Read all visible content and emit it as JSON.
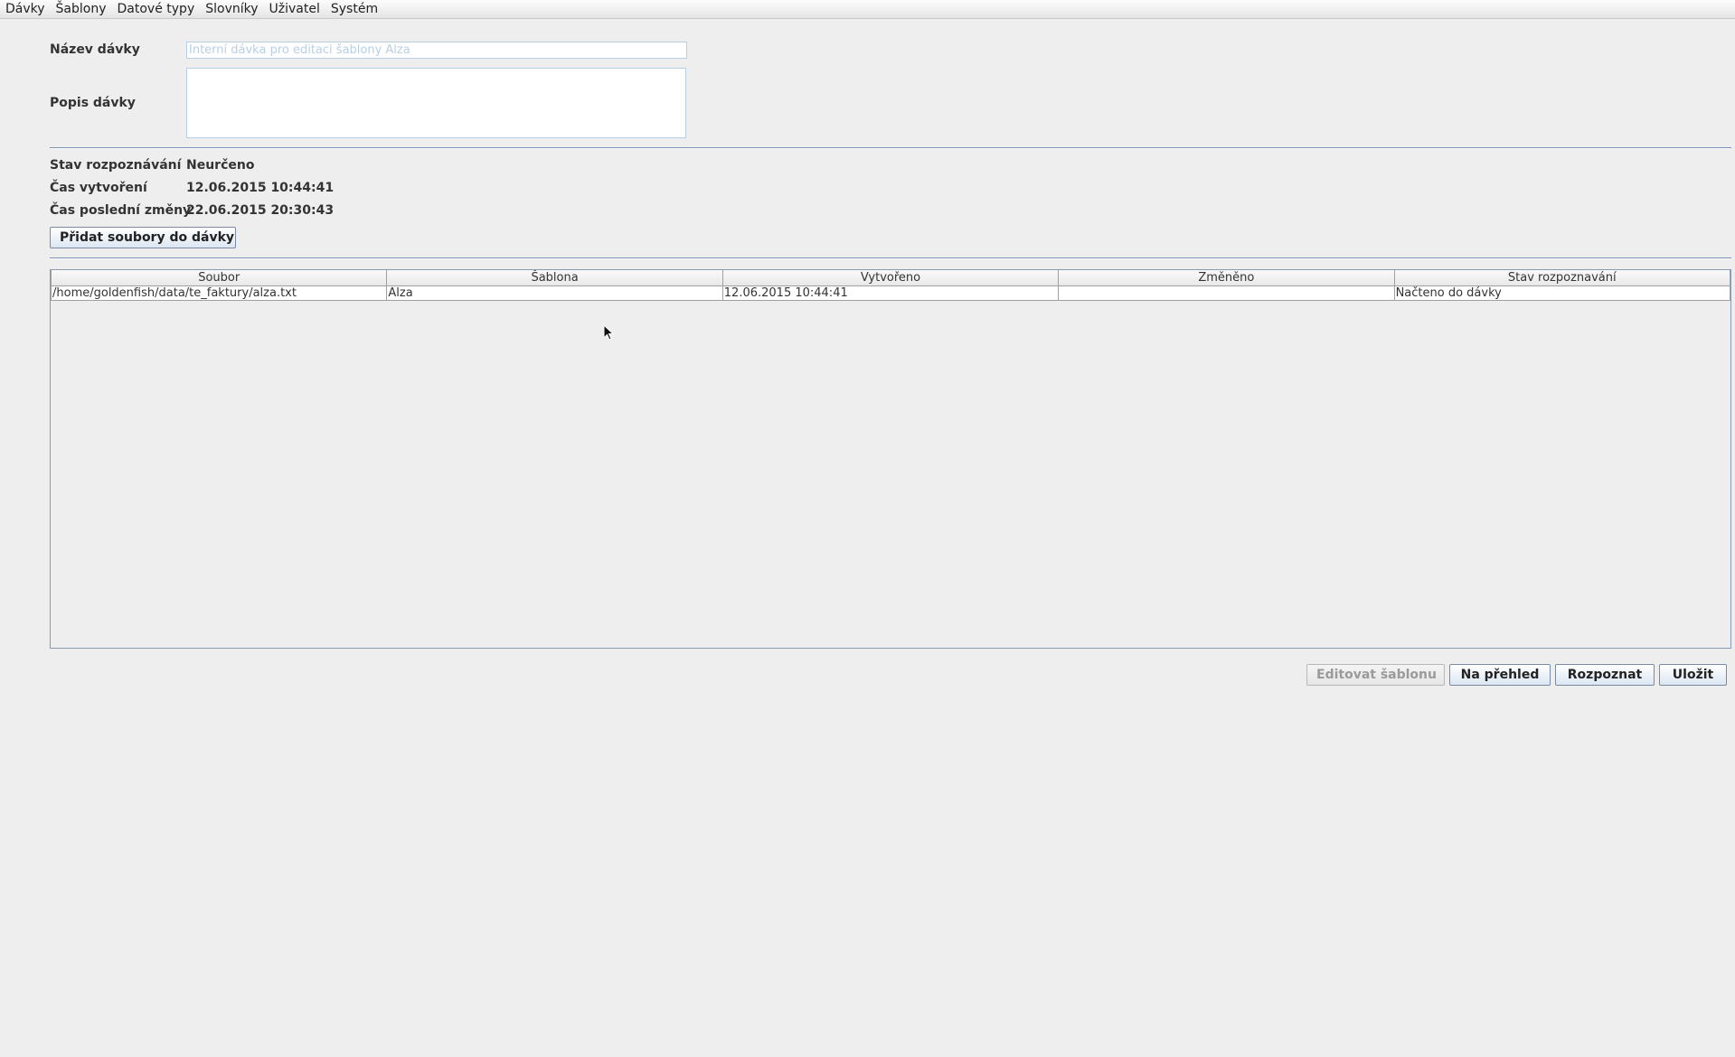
{
  "menu": [
    "Dávky",
    "Šablony",
    "Datové typy",
    "Slovníky",
    "Uživatel",
    "Systém"
  ],
  "form": {
    "name_label": "Název dávky",
    "name_placeholder": "Interní dávka pro editaci šablony Alza",
    "name_value": "",
    "description_label": "Popis dávky",
    "description_value": ""
  },
  "info": {
    "status_label": "Stav rozpoznávání",
    "status_value": "Neurčeno",
    "created_label": "Čas vytvoření",
    "created_value": "12.06.2015 10:44:41",
    "modified_label": "Čas poslední změny",
    "modified_value": "22.06.2015 20:30:43"
  },
  "add_files_button": "Přidat soubory do dávky",
  "table": {
    "columns": [
      "Soubor",
      "Šablona",
      "Vytvořeno",
      "Změněno",
      "Stav rozpoznavání"
    ],
    "rows": [
      [
        "/home/goldenfish/data/te_faktury/alza.txt",
        "Alza",
        "12.06.2015 10:44:41",
        "",
        "Načteno do dávky"
      ]
    ]
  },
  "actions": {
    "edit_template": "Editovat šablonu",
    "overview": "Na přehled",
    "recognize": "Rozpoznat",
    "save": "Uložit"
  }
}
